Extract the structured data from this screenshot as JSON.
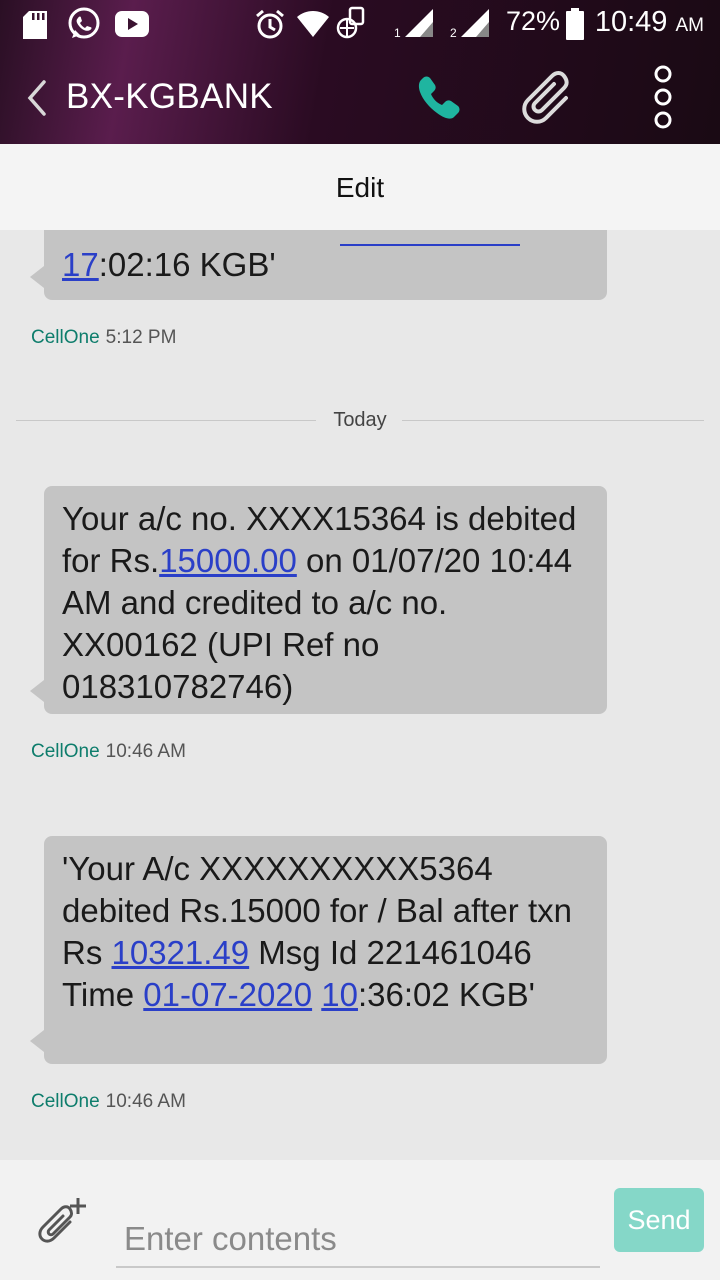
{
  "status_bar": {
    "battery_percent": "72%",
    "time": "10:49",
    "ampm": "AM",
    "sim1_label": "1",
    "sim2_label": "2",
    "icons": [
      "sd-card-icon",
      "whatsapp-icon",
      "youtube-icon",
      "alarm-icon",
      "wifi-icon",
      "sim-tool-icon",
      "signal-icon",
      "battery-icon"
    ]
  },
  "header": {
    "title": "BX-KGBANK",
    "accent_color": "#1fb5a0"
  },
  "edit_bar": {
    "label": "Edit"
  },
  "messages": [
    {
      "parts": [
        {
          "text": "17",
          "link": true
        },
        {
          "text": ":02:16 KGB'",
          "link": false
        }
      ],
      "sender": "CellOne",
      "time": "5:12 PM"
    },
    {
      "parts": [
        {
          "text": "Your a/c no. XXXX15364 is debited for Rs.",
          "link": false
        },
        {
          "text": "15000.00",
          "link": true
        },
        {
          "text": " on 01/07/20 10:44 AM and credited to a/c no. XX00162 (UPI Ref no 018310782746)",
          "link": false
        }
      ],
      "sender": "CellOne",
      "time": "10:46 AM"
    },
    {
      "parts": [
        {
          "text": "'Your A/c XXXXXXXXXX5364 debited Rs.15000 for / Bal after txn Rs ",
          "link": false
        },
        {
          "text": "10321.49",
          "link": true
        },
        {
          "text": " Msg Id 221461046 Time ",
          "link": false
        },
        {
          "text": "01-07-2020",
          "link": true
        },
        {
          "text": " ",
          "link": false
        },
        {
          "text": "10",
          "link": true
        },
        {
          "text": ":36:02 KGB'",
          "link": false
        }
      ],
      "sender": "CellOne",
      "time": "10:46 AM"
    }
  ],
  "date_divider": "Today",
  "compose": {
    "placeholder": "Enter contents",
    "send_label": "Send"
  }
}
